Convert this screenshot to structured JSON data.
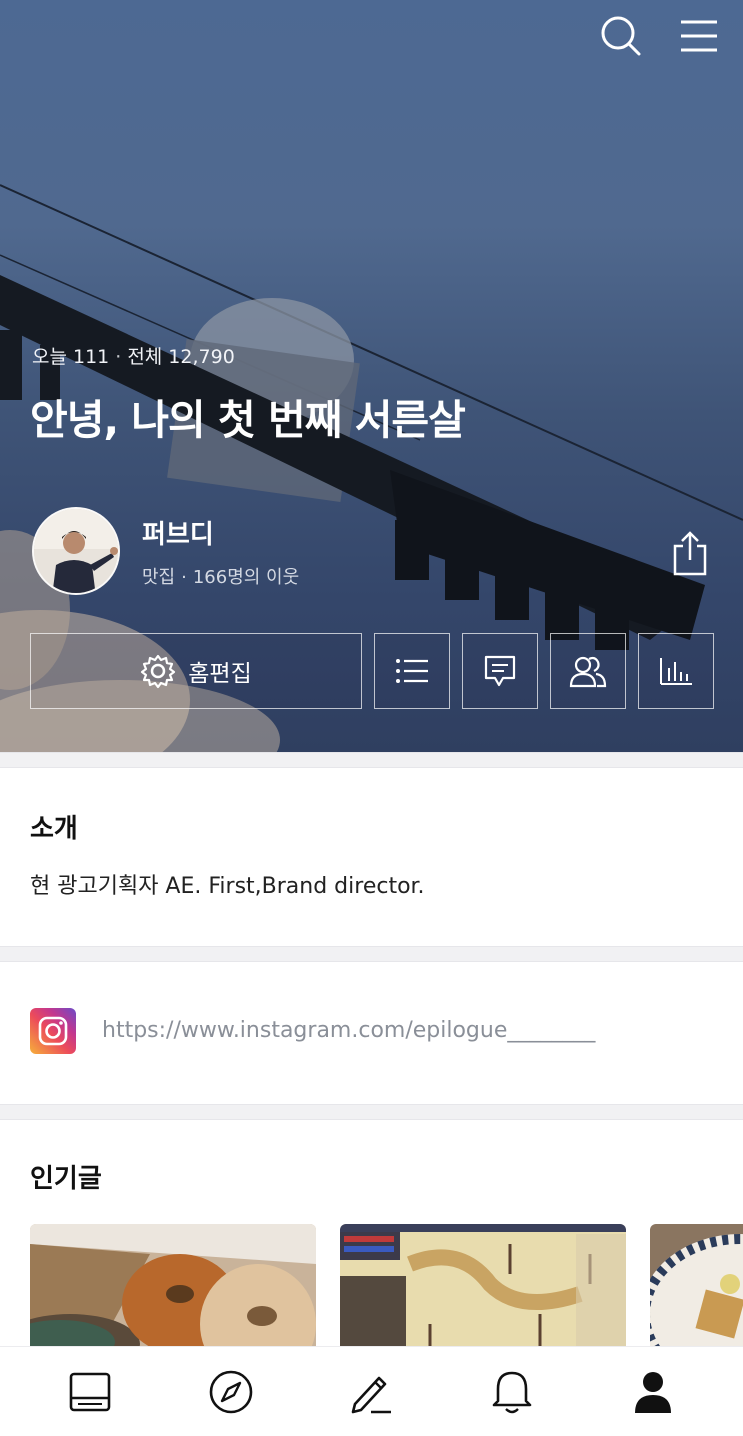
{
  "stats": {
    "today_label": "오늘 111",
    "total_label": "전체 12,790"
  },
  "blog": {
    "title": "안녕, 나의 첫 번째 서른살"
  },
  "profile": {
    "nickname": "퍼브디",
    "category": "맛집",
    "neighbors": "166명의 이웃"
  },
  "actions": {
    "edit_home_label": "홈편집"
  },
  "intro": {
    "heading": "소개",
    "text": "현 광고기획자 AE. First,Brand director."
  },
  "link": {
    "url": "https://www.instagram.com/epilogue________"
  },
  "popular": {
    "heading": "인기글"
  },
  "icons": {
    "search": "search-icon",
    "menu": "menu-icon",
    "share": "share-icon",
    "gear": "gear-icon",
    "list": "list-icon",
    "comment": "comment-icon",
    "neighbors": "neighbors-icon",
    "stats": "stats-icon",
    "feed": "feed-icon",
    "explore": "compass-icon",
    "write": "pencil-icon",
    "notifications": "bell-icon",
    "my": "person-icon"
  },
  "colors": {
    "hero_sky": "#4d6993",
    "link_gray": "#8a8f98",
    "instagram": "#ec4b5b"
  }
}
